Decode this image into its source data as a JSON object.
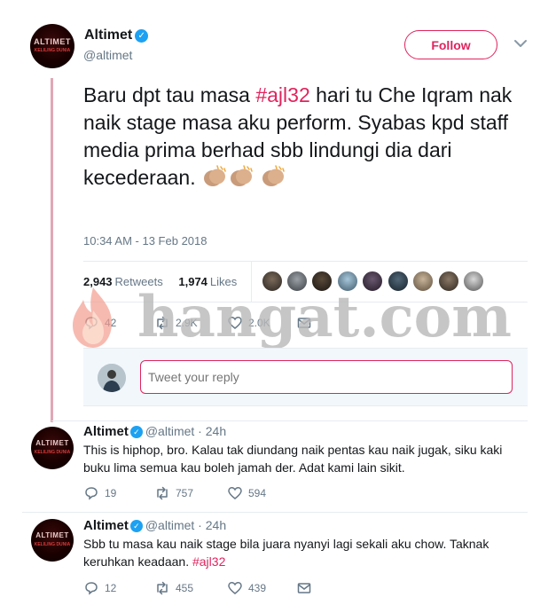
{
  "tweet": {
    "avatar_lines": [
      "ALTIMET",
      "KELILING DUNIA"
    ],
    "author_name": "Altimet",
    "author_handle": "@altimet",
    "follow_label": "Follow",
    "text_part1": "Baru dpt tau masa ",
    "hashtag": "#ajl32",
    "text_part2": " hari tu Che Iqram nak naik stage masa aku perform. Syabas kpd staff media prima berhad sbb lindungi dia dari kecederaan.",
    "emojis": [
      "clapping-hands-emoji",
      "clapping-hands-emoji",
      "clapping-hands-emoji"
    ],
    "timestamp": "10:34 AM - 13 Feb 2018",
    "retweet_count": "2,943",
    "retweets_label": "Retweets",
    "like_count": "1,974",
    "likes_label": "Likes",
    "likers": 9,
    "actions": {
      "replies": "42",
      "retweets": "2.9K",
      "likes": "2.0K"
    }
  },
  "watermark": {
    "text": "hangat.com"
  },
  "reply_box": {
    "placeholder": "Tweet your reply"
  },
  "replies": [
    {
      "name": "Altimet",
      "handle": "@altimet",
      "time": "24h",
      "text": "This is hiphop, bro. Kalau tak diundang naik pentas kau naik jugak, siku kaki buku lima semua kau boleh jamah der. Adat kami lain sikit.",
      "replies": "19",
      "retweets": "757",
      "likes": "594"
    },
    {
      "name": "Altimet",
      "handle": "@altimet",
      "time": "24h",
      "text_part1": "Sbb tu masa kau naik stage bila juara nyanyi lagi sekali aku chow. Taknak keruhkan keadaan. ",
      "hashtag": "#ajl32",
      "replies": "12",
      "retweets": "455",
      "likes": "439"
    }
  ],
  "colors": {
    "accent": "#e0245e",
    "verified": "#1da1f2",
    "secondary_text": "#657786",
    "thread_line": "#e1a7b5"
  }
}
